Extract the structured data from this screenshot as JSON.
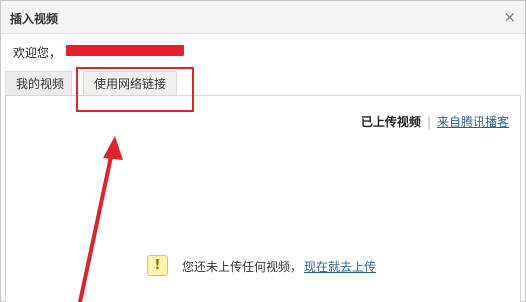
{
  "dialog": {
    "title": "插入视频",
    "close_symbol": "×",
    "welcome": "欢迎您，"
  },
  "tabs": [
    {
      "label": "我的视频"
    },
    {
      "label": "使用网络链接"
    }
  ],
  "content": {
    "uploaded_label": "已上传视频",
    "separator": "|",
    "tencent_link": "来自腾讯播客",
    "empty_notice": "您还未上传任何视频，",
    "upload_now_link": "现在就去上传",
    "notice_icon_glyph": "!"
  },
  "annotation": {
    "color": "#d9262a"
  }
}
